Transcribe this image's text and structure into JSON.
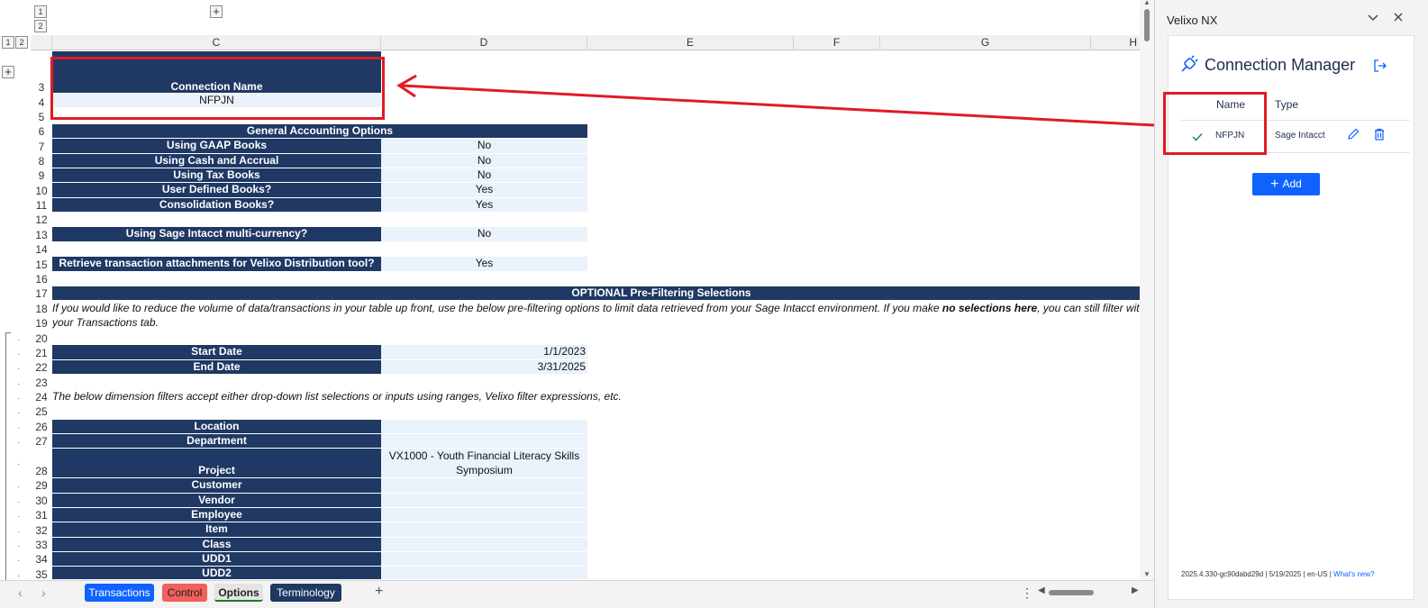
{
  "outline": {
    "level1": "1",
    "level2": "2",
    "expand": "+"
  },
  "columns": [
    "C",
    "D",
    "E",
    "F",
    "G",
    "H"
  ],
  "rows": {
    "r3": {
      "num": "3",
      "c": "Connection Name"
    },
    "r4": {
      "num": "4",
      "c": "NFPJN"
    },
    "r5": {
      "num": "5"
    },
    "r6": {
      "num": "6",
      "cd": "General Accounting Options"
    },
    "r7": {
      "num": "7",
      "c": "Using GAAP Books",
      "d": "No"
    },
    "r8": {
      "num": "8",
      "c": "Using Cash and Accrual",
      "d": "No"
    },
    "r9": {
      "num": "9",
      "c": "Using Tax Books",
      "d": "No"
    },
    "r10": {
      "num": "10",
      "c": "User Defined Books?",
      "d": "Yes"
    },
    "r11": {
      "num": "11",
      "c": "Consolidation Books?",
      "d": "Yes"
    },
    "r12": {
      "num": "12"
    },
    "r13": {
      "num": "13",
      "c": "Using Sage Intacct multi-currency?",
      "d": "No"
    },
    "r14": {
      "num": "14"
    },
    "r15": {
      "num": "15",
      "c": "Retrieve transaction attachments for Velixo Distribution tool?",
      "d": "Yes"
    },
    "r16": {
      "num": "16"
    },
    "r17": {
      "num": "17",
      "wide": "OPTIONAL Pre-Filtering Selections"
    },
    "r18": {
      "num": "18",
      "text_a": "If you would like to reduce the volume of data/transactions in your table up front, use the below pre-filtering options to limit data retrieved from your Sage Intacct environment. If you make ",
      "text_b": "no selections here",
      "text_c": ", you can still filter within t"
    },
    "r19": {
      "num": "19",
      "text": "your Transactions tab."
    },
    "r20": {
      "num": "20"
    },
    "r21": {
      "num": "21",
      "c": "Start Date",
      "d": "1/1/2023"
    },
    "r22": {
      "num": "22",
      "c": "End Date",
      "d": "3/31/2025"
    },
    "r23": {
      "num": "23"
    },
    "r24": {
      "num": "24",
      "text": "The below dimension filters accept either drop-down list selections or inputs using ranges, Velixo filter expressions, etc."
    },
    "r25": {
      "num": "25"
    },
    "r26": {
      "num": "26",
      "c": "Location"
    },
    "r27": {
      "num": "27",
      "c": "Department"
    },
    "r28": {
      "num": "28",
      "c": "Project",
      "d1": "VX1000 - Youth Financial Literacy Skills",
      "d2": "Symposium"
    },
    "r29": {
      "num": "29",
      "c": "Customer"
    },
    "r30": {
      "num": "30",
      "c": "Vendor"
    },
    "r31": {
      "num": "31",
      "c": "Employee"
    },
    "r32": {
      "num": "32",
      "c": "Item"
    },
    "r33": {
      "num": "33",
      "c": "Class"
    },
    "r34": {
      "num": "34",
      "c": "UDD1"
    },
    "r35": {
      "num": "35",
      "c": "UDD2"
    }
  },
  "sheet_tabs": [
    {
      "label": "Transactions",
      "color": "#0f62fe"
    },
    {
      "label": "Control",
      "color": "#f0605d"
    },
    {
      "label": "Options",
      "color": "#e0e0e0",
      "active": true
    },
    {
      "label": "Terminology",
      "color": "#1f3864"
    }
  ],
  "tabbar": {
    "add": "+",
    "more": "⋮",
    "prev": "‹",
    "next": "›"
  },
  "pane": {
    "title": "Velixo NX",
    "connection_manager": "Connection Manager",
    "col_name": "Name",
    "col_type": "Type",
    "conn_name": "NFPJN",
    "conn_type": "Sage Intacct",
    "add_label": "Add",
    "footer": "2025.4.330-gc90dabd29d | 5/19/2025 | en-US | ",
    "whats_new": "What's new?"
  },
  "colors": {
    "header_navy": "#1f3864",
    "input_blue": "#eaf2fb",
    "accent": "#0f62fe",
    "annotation_red": "#e01b24"
  }
}
